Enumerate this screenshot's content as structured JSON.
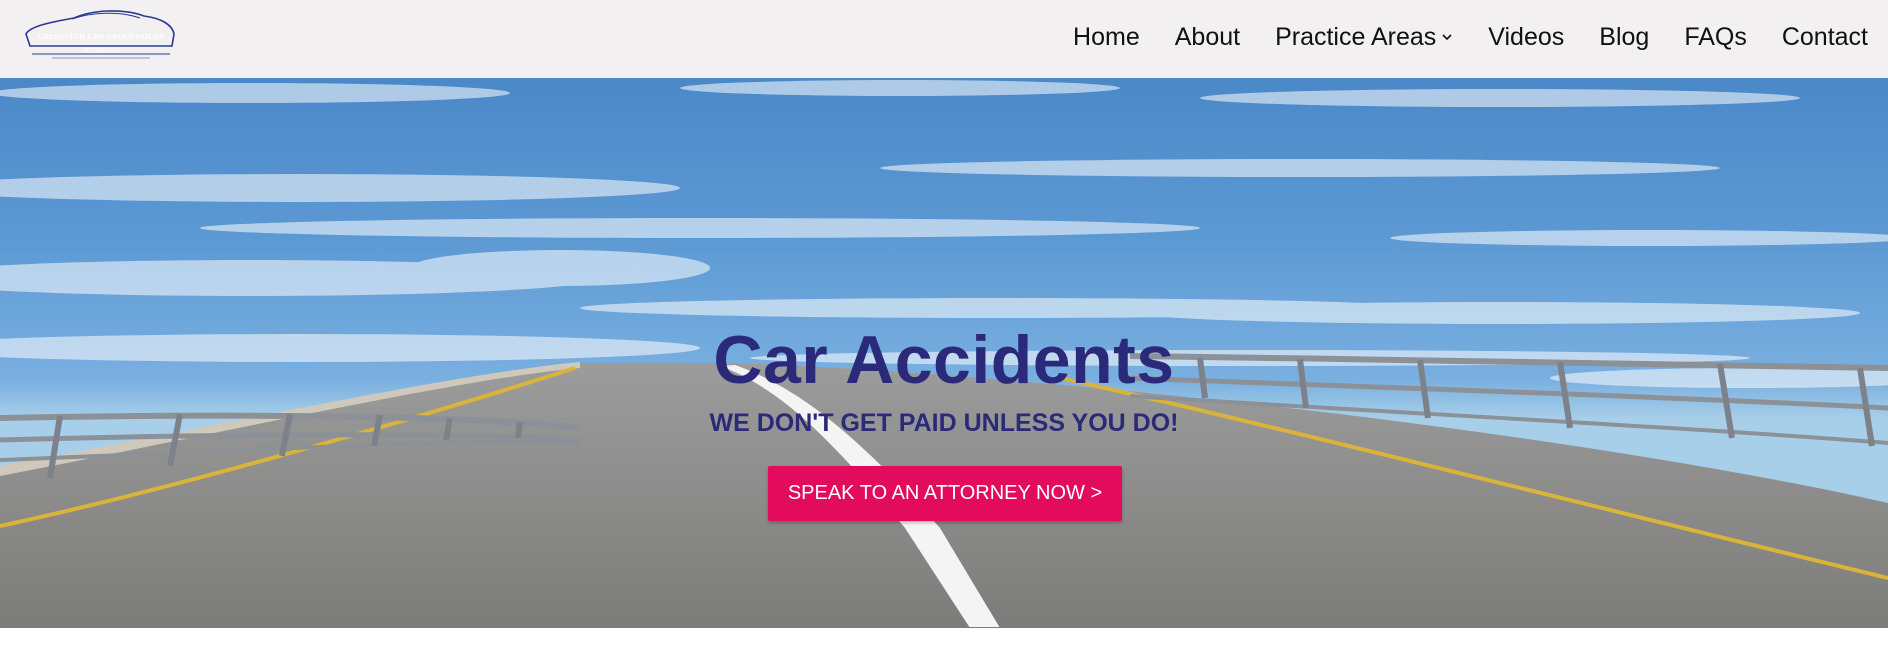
{
  "header": {
    "logo": {
      "text": "CARSWITCH LAW GROUP INJURY",
      "subtext": "ATTORNEYS",
      "brand_color": "#2b3a8f"
    },
    "nav": [
      {
        "label": "Home"
      },
      {
        "label": "About"
      },
      {
        "label": "Practice Areas",
        "icon": "chevron-down-icon"
      },
      {
        "label": "Videos"
      },
      {
        "label": "Blog"
      },
      {
        "label": "FAQs"
      },
      {
        "label": "Contact"
      }
    ]
  },
  "hero": {
    "title": "Car Accidents",
    "subtitle": "WE DON'T GET PAID UNLESS YOU DO!",
    "cta_label": "SPEAK TO AN ATTORNEY NOW >",
    "title_color": "#2b2a7a",
    "cta_color": "#e30b5c"
  }
}
